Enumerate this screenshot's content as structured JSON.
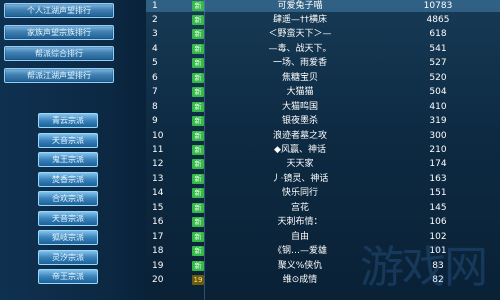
{
  "left_panel": {
    "top_buttons": [
      "个人江湖声望排行",
      "家族声望宗族排行",
      "帮派综合排行",
      "帮派江湖声望排行"
    ],
    "category_buttons": [
      "青云宗派",
      "天音宗派",
      "鬼王宗派",
      "焚香宗派",
      "合欢宗派",
      "天音宗派",
      "狐岐宗派",
      "灵汐宗派",
      "帝王宗派"
    ]
  },
  "table": {
    "rows": [
      {
        "rank": "1",
        "badge": "新",
        "name": "可爱兔子喵",
        "score": "10783"
      },
      {
        "rank": "2",
        "badge": "新",
        "name": "肆遥—††横床",
        "score": "4865"
      },
      {
        "rank": "3",
        "badge": "新",
        "name": "＜野蛮天下＞—",
        "score": "618"
      },
      {
        "rank": "4",
        "badge": "新",
        "name": "—毒、战天下。",
        "score": "541"
      },
      {
        "rank": "5",
        "badge": "新",
        "name": "一场、雨爱香",
        "score": "527"
      },
      {
        "rank": "6",
        "badge": "新",
        "name": "焦糖宝贝",
        "score": "520"
      },
      {
        "rank": "7",
        "badge": "新",
        "name": "大猫猫",
        "score": "504"
      },
      {
        "rank": "8",
        "badge": "新",
        "name": "大猫鸣国",
        "score": "410"
      },
      {
        "rank": "9",
        "badge": "新",
        "name": "银夜墨杀",
        "score": "319"
      },
      {
        "rank": "10",
        "badge": "新",
        "name": "浪迹者墓之攻",
        "score": "300"
      },
      {
        "rank": "11",
        "badge": "新",
        "name": "◆风赢、神话",
        "score": "210"
      },
      {
        "rank": "12",
        "badge": "新",
        "name": "天天家",
        "score": "174"
      },
      {
        "rank": "13",
        "badge": "新",
        "name": "丿·镜灵、神话",
        "score": "163"
      },
      {
        "rank": "14",
        "badge": "新",
        "name": "快乐同行",
        "score": "151"
      },
      {
        "rank": "15",
        "badge": "新",
        "name": "宫花",
        "score": "145"
      },
      {
        "rank": "16",
        "badge": "新",
        "name": "天刺布情：",
        "score": "106"
      },
      {
        "rank": "17",
        "badge": "新",
        "name": "自由",
        "score": "102"
      },
      {
        "rank": "18",
        "badge": "新",
        "name": "《钢…—爱雄",
        "score": "101"
      },
      {
        "rank": "19",
        "badge": "新",
        "name": "聚义%侠仇",
        "score": "83"
      },
      {
        "rank": "20",
        "badge": "19",
        "name": "维⊙成情",
        "score": "82"
      }
    ]
  },
  "watermark": "游戏网"
}
